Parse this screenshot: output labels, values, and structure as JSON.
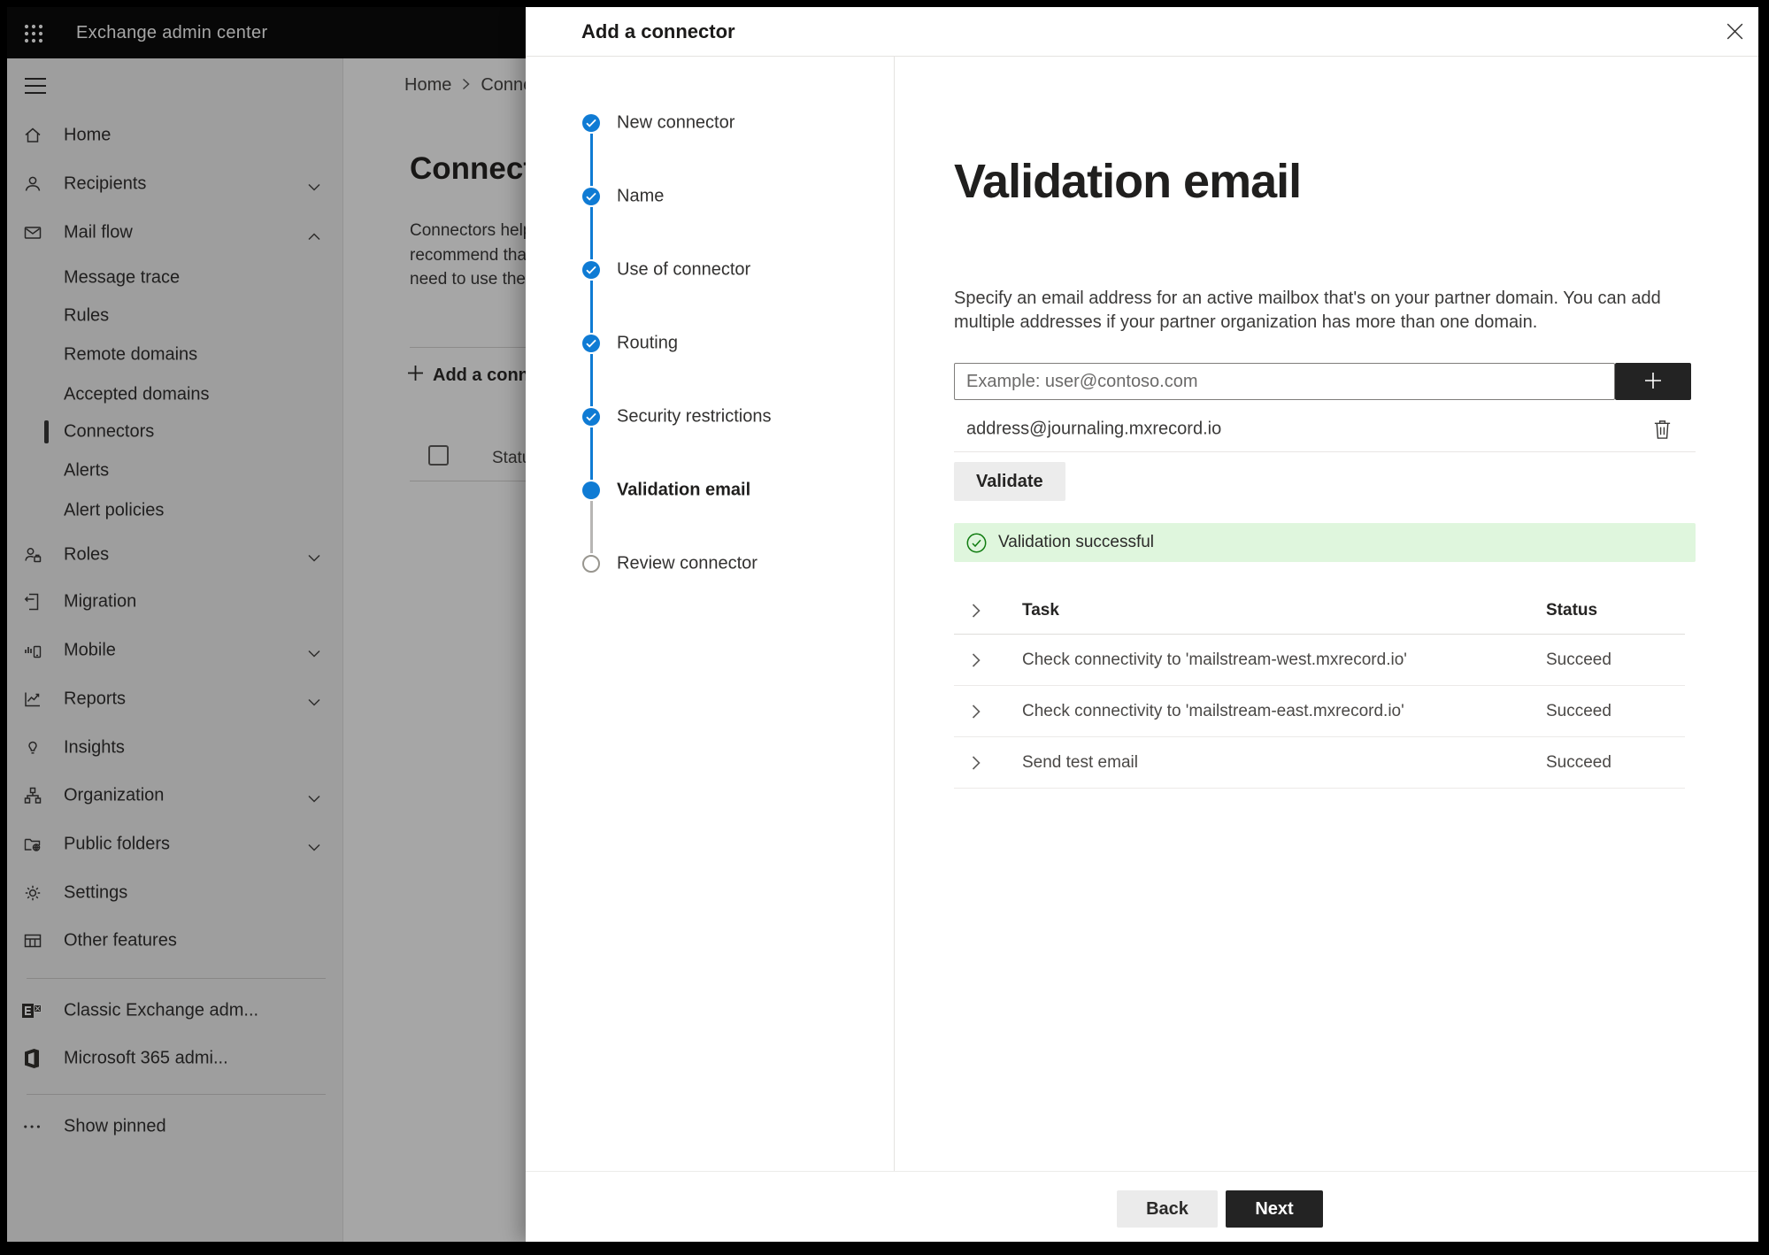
{
  "topbar": {
    "title": "Exchange admin center"
  },
  "sidebar": {
    "items": [
      {
        "label": "Home"
      },
      {
        "label": "Recipients",
        "chevron": "down"
      },
      {
        "label": "Mail flow",
        "chevron": "up"
      },
      {
        "label": "Roles",
        "chevron": "down"
      },
      {
        "label": "Migration"
      },
      {
        "label": "Mobile",
        "chevron": "down"
      },
      {
        "label": "Reports",
        "chevron": "down"
      },
      {
        "label": "Insights"
      },
      {
        "label": "Organization",
        "chevron": "down"
      },
      {
        "label": "Public folders",
        "chevron": "down"
      },
      {
        "label": "Settings"
      },
      {
        "label": "Other features"
      }
    ],
    "mailflow_children": [
      "Message trace",
      "Rules",
      "Remote domains",
      "Accepted domains",
      "Connectors",
      "Alerts",
      "Alert policies"
    ],
    "selected_item": "Connectors",
    "footer_links": [
      "Classic Exchange adm...",
      "Microsoft 365 admi..."
    ],
    "show_pinned": "Show pinned"
  },
  "page": {
    "breadcrumb_home": "Home",
    "breadcrumb_current": "Connectors",
    "title": "Connectors",
    "intro_lines": [
      "Connectors help",
      "recommend that",
      "need to use the"
    ],
    "add_button": "Add a connector",
    "status_column": "Status"
  },
  "dialog": {
    "title": "Add a connector",
    "steps": [
      {
        "label": "New connector",
        "state": "done"
      },
      {
        "label": "Name",
        "state": "done"
      },
      {
        "label": "Use of connector",
        "state": "done"
      },
      {
        "label": "Routing",
        "state": "done"
      },
      {
        "label": "Security restrictions",
        "state": "done"
      },
      {
        "label": "Validation email",
        "state": "current"
      },
      {
        "label": "Review connector",
        "state": "upcoming"
      }
    ],
    "heading": "Validation email",
    "description_lines": [
      "Specify an email address for an active mailbox that's on your partner domain. You can add",
      "multiple addresses if your partner organization has more than one domain."
    ],
    "email_placeholder": "Example: user@contoso.com",
    "address": "address@journaling.mxrecord.io",
    "validate_button": "Validate",
    "success_message": "Validation successful",
    "table": {
      "task_header": "Task",
      "status_header": "Status",
      "rows": [
        {
          "task": "Check connectivity to 'mailstream-west.mxrecord.io'",
          "status": "Succeed"
        },
        {
          "task": "Check connectivity to 'mailstream-east.mxrecord.io'",
          "status": "Succeed"
        },
        {
          "task": "Send test email",
          "status": "Succeed"
        }
      ]
    },
    "back_button": "Back",
    "next_button": "Next"
  },
  "colors": {
    "accent_blue": "#0f7bd4",
    "success_green": "#107c10",
    "success_banner_bg": "#dff6dd",
    "dark_button_bg": "#232323",
    "light_button_bg": "#ececec",
    "topbar_bg": "#0c0c0c"
  }
}
